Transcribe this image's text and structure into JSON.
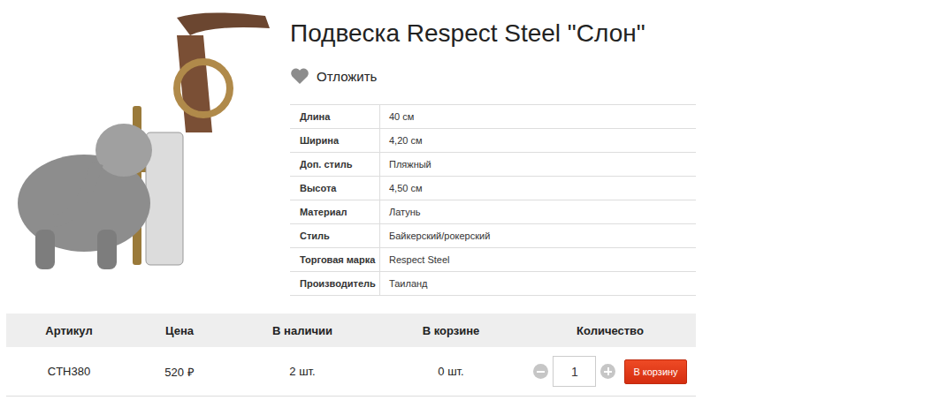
{
  "product": {
    "title": "Подвеска Respect Steel \"Слон\"",
    "wishlist_label": "Отложить"
  },
  "specs": [
    {
      "label": "Длина",
      "value": "40 см"
    },
    {
      "label": "Ширина",
      "value": "4,20 см"
    },
    {
      "label": "Доп. стиль",
      "value": "Пляжный"
    },
    {
      "label": "Высота",
      "value": "4,50 см"
    },
    {
      "label": "Материал",
      "value": "Латунь"
    },
    {
      "label": "Стиль",
      "value": "Байкерский/рокерский"
    },
    {
      "label": "Торговая марка",
      "value": "Respect Steel"
    },
    {
      "label": "Производитель",
      "value": "Таиланд"
    }
  ],
  "offer_table": {
    "columns": [
      "Артикул",
      "Цена",
      "В наличии",
      "В корзине",
      "Количество"
    ],
    "row": {
      "sku": "CTH380",
      "price": "520 ₽",
      "stock": "2 шт.",
      "in_cart": "0 шт.",
      "quantity": "1"
    }
  },
  "buttons": [
    "В корзину"
  ]
}
